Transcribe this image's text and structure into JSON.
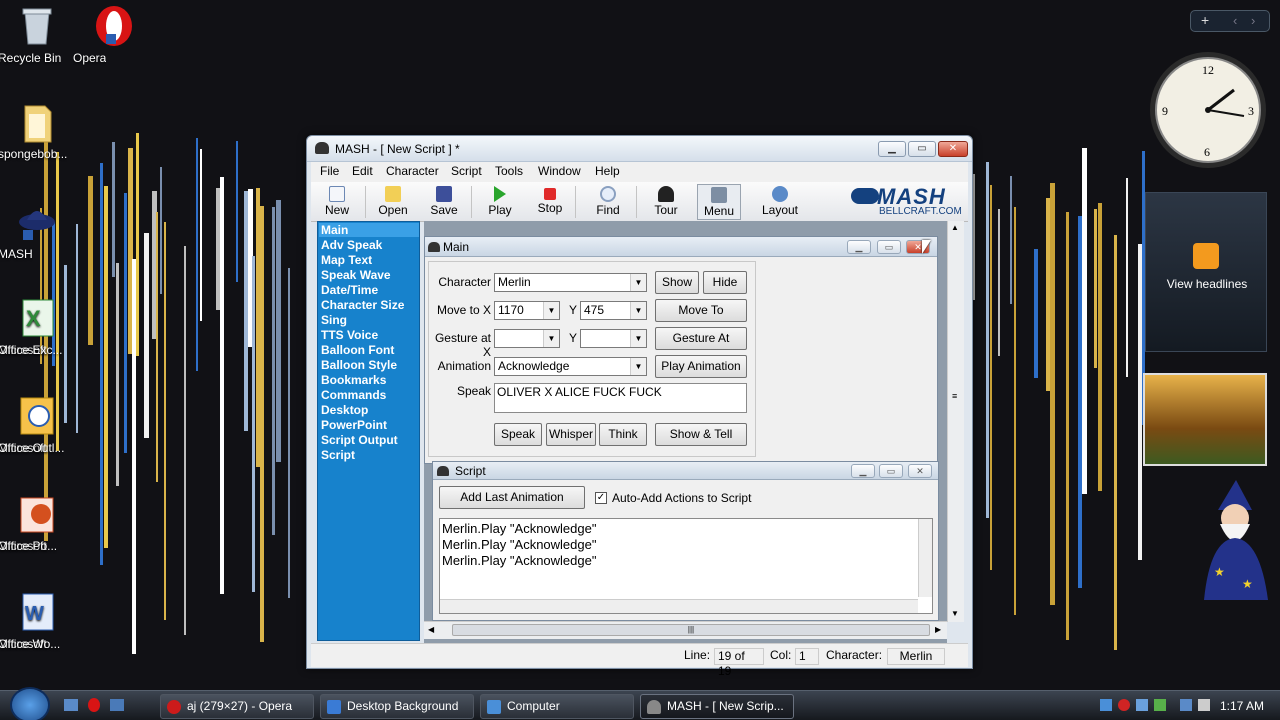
{
  "desktop": {
    "icons": [
      {
        "label": "Recycle Bin",
        "icon": "recycle-bin-icon"
      },
      {
        "label": "Opera",
        "icon": "opera-icon"
      },
      {
        "label": "spongebob...",
        "icon": "folder-icon"
      },
      {
        "label": "MASH",
        "icon": "mash-icon"
      },
      {
        "label_1": "Microsoft",
        "label_2": "Office Exc...",
        "icon": "excel-icon"
      },
      {
        "label_1": "Microsoft",
        "label_2": "Office Outl...",
        "icon": "outlook-icon"
      },
      {
        "label_1": "Microsoft",
        "label_2": "Office Po...",
        "icon": "powerpoint-icon"
      },
      {
        "label_1": "Microsoft",
        "label_2": "Office Wo...",
        "icon": "word-icon"
      }
    ]
  },
  "sidebar_gadgets": {
    "rss_label": "View headlines",
    "top_controls": [
      "+",
      "‹",
      "›"
    ]
  },
  "window": {
    "title": "MASH - [ New Script ] *",
    "menu": [
      "File",
      "Edit",
      "Character",
      "Script",
      "Tools",
      "Window",
      "Help"
    ],
    "toolbar": [
      "New",
      "Open",
      "Save",
      "Play",
      "Stop",
      "Find",
      "Tour",
      "Menu",
      "Layout"
    ],
    "logo_text": "MASH",
    "logo_sub": "BELLCRAFT.COM",
    "sidebar": [
      "Main",
      "Adv Speak",
      "Map Text",
      "Speak Wave",
      "Date/Time",
      "Character Size",
      "Sing",
      "TTS Voice",
      "Balloon Font",
      "Balloon Style",
      "Bookmarks",
      "Commands",
      "Desktop",
      "PowerPoint",
      "Script Output",
      "Script"
    ],
    "status": {
      "line_label": "Line:",
      "line_value": "19 of 19",
      "col_label": "Col:",
      "col_value": "1",
      "char_label": "Character:",
      "char_value": "Merlin"
    }
  },
  "main_panel": {
    "title": "Main",
    "character_label": "Character",
    "character_value": "Merlin",
    "show": "Show",
    "hide": "Hide",
    "move_label": "Move to X",
    "move_x": "1170",
    "y_label": "Y",
    "move_y": "475",
    "move_button": "Move To",
    "gesture_label": "Gesture at X",
    "gesture_x": "",
    "gesture_y": "",
    "gesture_button": "Gesture At",
    "animation_label": "Animation",
    "animation_value": "Acknowledge",
    "play_animation": "Play Animation",
    "speak_label": "Speak",
    "speak_text": "OLIVER X ALICE FUCK FUCK",
    "buttons": [
      "Speak",
      "Whisper",
      "Think",
      "Show & Tell"
    ]
  },
  "script_panel": {
    "title": "Script",
    "add_last": "Add Last Animation",
    "auto_add": "Auto-Add Actions to Script",
    "auto_add_checked": true,
    "lines": [
      "Merlin.Play \"Acknowledge\"",
      "Merlin.Play \"Acknowledge\"",
      "Merlin.Play \"Acknowledge\""
    ]
  },
  "taskbar": {
    "items": [
      {
        "label": "aj (279×27) - Opera",
        "icon": "opera-task-icon",
        "color": "#cc1b1b"
      },
      {
        "label": "Desktop Background",
        "icon": "desktop-background-task-icon",
        "color": "#3a7bd5"
      },
      {
        "label": "Computer",
        "icon": "computer-task-icon",
        "color": "#4a8fd8"
      },
      {
        "label": "MASH - [ New Scrip...",
        "icon": "mash-task-icon",
        "color": "#888888"
      }
    ],
    "clock": "1:17 AM"
  }
}
